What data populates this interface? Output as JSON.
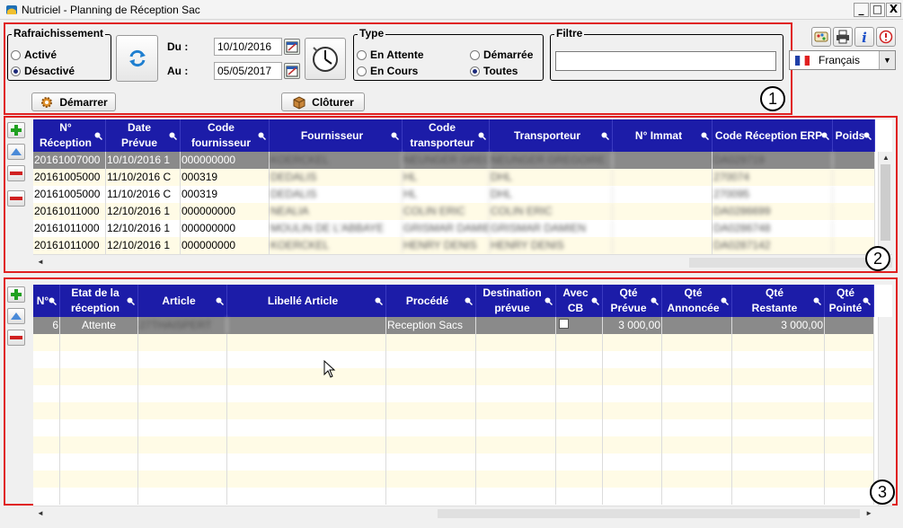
{
  "window": {
    "title": "Nutriciel - Planning de Réception Sac",
    "min": "_",
    "max": "□",
    "close": "X"
  },
  "refresh": {
    "legend": "Rafraichissement",
    "options": [
      {
        "label": "Activé",
        "selected": false
      },
      {
        "label": "Désactivé",
        "selected": true
      }
    ]
  },
  "dates": {
    "from_label": "Du :",
    "from_value": "10/10/2016",
    "to_label": "Au :",
    "to_value": "05/05/2017"
  },
  "type": {
    "legend": "Type",
    "options": [
      {
        "label": "En Attente",
        "selected": false
      },
      {
        "label": "Démarrée",
        "selected": false
      },
      {
        "label": "En Cours",
        "selected": false
      },
      {
        "label": "Toutes",
        "selected": true
      }
    ]
  },
  "filter": {
    "legend": "Filtre",
    "value": ""
  },
  "language": {
    "selected": "Français"
  },
  "actions": {
    "start_label": "Démarrer",
    "close_label": "Clôturer"
  },
  "badges": [
    "1",
    "2",
    "3"
  ],
  "reception_grid": {
    "columns": [
      "N°\nRéception",
      "Date\nPrévue",
      "Code\nfournisseur",
      "Fournisseur",
      "Code\ntransporteur",
      "Transporteur",
      "N° Immat",
      "Code Réception ERP",
      "Poids"
    ],
    "rows": [
      [
        "20161007000",
        "10/10/2016 1",
        "000000000",
        "KOERCKEL",
        "NEUNGER GREGOIRE",
        "NEUNGER GREGOIRE",
        "",
        "DA029719",
        ""
      ],
      [
        "20161005000",
        "11/10/2016 C",
        "000319",
        "DEDALIS",
        "HL",
        "DHL",
        "",
        "270074",
        ""
      ],
      [
        "20161005000",
        "11/10/2016 C",
        "000319",
        "DEDALIS",
        "HL",
        "DHL",
        "",
        "270095",
        ""
      ],
      [
        "20161011000",
        "12/10/2016 1",
        "000000000",
        "NEALIA",
        "COLIN ERIC",
        "COLIN ERIC",
        "",
        "DA0286699",
        ""
      ],
      [
        "20161011000",
        "12/10/2016 1",
        "000000000",
        "MOULIN DE L'ABBAYE",
        "GRISMAR DAMIEN",
        "GRISMAR DAMIEN",
        "",
        "DA0286748",
        ""
      ],
      [
        "20161011000",
        "12/10/2016 1",
        "000000000",
        "KOERCKEL",
        "HENRY DENIS",
        "HENRY DENIS",
        "",
        "DA0287142",
        ""
      ]
    ]
  },
  "detail_grid": {
    "columns": [
      "N°",
      "Etat de la\nréception",
      "Article",
      "Libellé Article",
      "Procédé",
      "Destination\nprévue",
      "Avec\nCB",
      "Qté\nPrévue",
      "Qté\nAnnoncée",
      "Qté\nRestante",
      "Qté\nPointé"
    ],
    "rows": [
      [
        "6",
        "Attente",
        "27THAISPERT",
        "",
        "Reception Sacs",
        "",
        "",
        "3 000,00",
        "",
        "3 000,00",
        ""
      ]
    ]
  },
  "colors": {
    "header_blue": "#1c1ca8",
    "selected_row": "#8a8a8a",
    "highlight_red": "#e02020"
  },
  "icons": [
    "app-icon",
    "refresh-icon",
    "calendar-icon",
    "clock-icon",
    "gear-icon",
    "box-icon",
    "palette-icon",
    "printer-icon",
    "info-icon",
    "power-icon",
    "french-flag-icon",
    "add-icon",
    "arrow-up-icon",
    "remove-icon",
    "magnifier-icon",
    "mouse-cursor-icon"
  ]
}
